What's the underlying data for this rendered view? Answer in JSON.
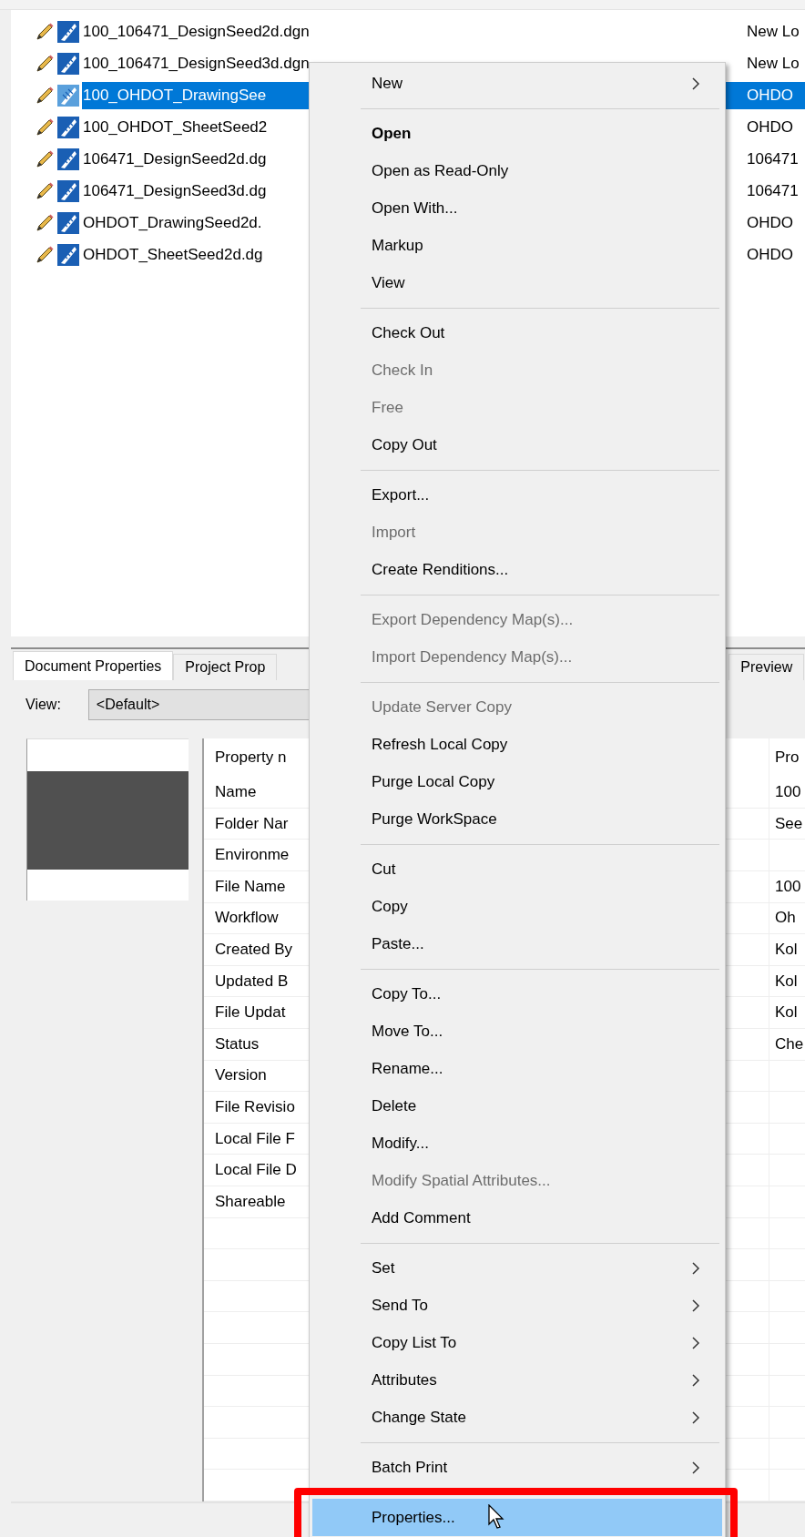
{
  "file_list": {
    "rows": [
      {
        "name": "100_106471_DesignSeed2d.dgn",
        "column_2": "New Lo",
        "selected": false
      },
      {
        "name": "100_106471_DesignSeed3d.dgn",
        "column_2": "New Lo",
        "selected": false
      },
      {
        "name": "100_OHDOT_DrawingSee",
        "column_2": "OHDO",
        "selected": true
      },
      {
        "name": "100_OHDOT_SheetSeed2",
        "column_2": "OHDO",
        "selected": false
      },
      {
        "name": "106471_DesignSeed2d.dg",
        "column_2": "106471",
        "selected": false
      },
      {
        "name": "106471_DesignSeed3d.dg",
        "column_2": "106471",
        "selected": false
      },
      {
        "name": "OHDOT_DrawingSeed2d.",
        "column_2": "OHDO",
        "selected": false
      },
      {
        "name": "OHDOT_SheetSeed2d.dg",
        "column_2": "OHDO",
        "selected": false
      }
    ]
  },
  "properties_panel": {
    "tabs": [
      {
        "label": "Document Properties",
        "selected": true
      },
      {
        "label": "Project Prop",
        "selected": false
      },
      {
        "label": "Preview",
        "selected": false
      }
    ],
    "view": {
      "label": "View:",
      "value": "<Default>"
    },
    "grid": {
      "columns": [
        "Property n",
        "Pro"
      ],
      "rows": [
        {
          "property": "Name",
          "value": "100"
        },
        {
          "property": "Folder Nar",
          "value": "See"
        },
        {
          "property": "Environme"
        },
        {
          "property": "File Name",
          "value": "100"
        },
        {
          "property": "Workflow",
          "value": "Oh"
        },
        {
          "property": "Created By",
          "value": "Kol"
        },
        {
          "property": "Updated B",
          "value": "Kol"
        },
        {
          "property": "File Updat",
          "value": "Kol"
        },
        {
          "property": "Status",
          "value": "Che"
        },
        {
          "property": "Version"
        },
        {
          "property": "File Revisio"
        },
        {
          "property": "Local File F"
        },
        {
          "property": "Local File D"
        },
        {
          "property": "Shareable"
        }
      ]
    }
  },
  "context_menu": {
    "items": [
      {
        "kind": "item",
        "label": "New",
        "bold": false,
        "disabled": false,
        "submenu": true,
        "selected": false
      },
      {
        "kind": "separator"
      },
      {
        "kind": "item",
        "label": "Open",
        "bold": true,
        "disabled": false,
        "submenu": false,
        "selected": false
      },
      {
        "kind": "item",
        "label": "Open as Read-Only",
        "bold": false,
        "disabled": false,
        "submenu": false,
        "selected": false
      },
      {
        "kind": "item",
        "label": "Open With...",
        "bold": false,
        "disabled": false,
        "submenu": false,
        "selected": false
      },
      {
        "kind": "item",
        "label": "Markup",
        "bold": false,
        "disabled": false,
        "submenu": false,
        "selected": false
      },
      {
        "kind": "item",
        "label": "View",
        "bold": false,
        "disabled": false,
        "submenu": false,
        "selected": false
      },
      {
        "kind": "separator"
      },
      {
        "kind": "item",
        "label": "Check Out",
        "bold": false,
        "disabled": false,
        "submenu": false,
        "selected": false
      },
      {
        "kind": "item",
        "label": "Check In",
        "bold": false,
        "disabled": true,
        "submenu": false,
        "selected": false
      },
      {
        "kind": "item",
        "label": "Free",
        "bold": false,
        "disabled": true,
        "submenu": false,
        "selected": false
      },
      {
        "kind": "item",
        "label": "Copy Out",
        "bold": false,
        "disabled": false,
        "submenu": false,
        "selected": false
      },
      {
        "kind": "separator"
      },
      {
        "kind": "item",
        "label": "Export...",
        "bold": false,
        "disabled": false,
        "submenu": false,
        "selected": false
      },
      {
        "kind": "item",
        "label": "Import",
        "bold": false,
        "disabled": true,
        "submenu": false,
        "selected": false
      },
      {
        "kind": "item",
        "label": "Create Renditions...",
        "bold": false,
        "disabled": false,
        "submenu": false,
        "selected": false
      },
      {
        "kind": "separator"
      },
      {
        "kind": "item",
        "label": "Export Dependency Map(s)...",
        "bold": false,
        "disabled": true,
        "submenu": false,
        "selected": false
      },
      {
        "kind": "item",
        "label": "Import Dependency Map(s)...",
        "bold": false,
        "disabled": true,
        "submenu": false,
        "selected": false
      },
      {
        "kind": "separator"
      },
      {
        "kind": "item",
        "label": "Update Server Copy",
        "bold": false,
        "disabled": true,
        "submenu": false,
        "selected": false
      },
      {
        "kind": "item",
        "label": "Refresh Local Copy",
        "bold": false,
        "disabled": false,
        "submenu": false,
        "selected": false
      },
      {
        "kind": "item",
        "label": "Purge Local Copy",
        "bold": false,
        "disabled": false,
        "submenu": false,
        "selected": false
      },
      {
        "kind": "item",
        "label": "Purge WorkSpace",
        "bold": false,
        "disabled": false,
        "submenu": false,
        "selected": false
      },
      {
        "kind": "separator"
      },
      {
        "kind": "item",
        "label": "Cut",
        "bold": false,
        "disabled": false,
        "submenu": false,
        "selected": false
      },
      {
        "kind": "item",
        "label": "Copy",
        "bold": false,
        "disabled": false,
        "submenu": false,
        "selected": false
      },
      {
        "kind": "item",
        "label": "Paste...",
        "bold": false,
        "disabled": false,
        "submenu": false,
        "selected": false
      },
      {
        "kind": "separator"
      },
      {
        "kind": "item",
        "label": "Copy To...",
        "bold": false,
        "disabled": false,
        "submenu": false,
        "selected": false
      },
      {
        "kind": "item",
        "label": "Move To...",
        "bold": false,
        "disabled": false,
        "submenu": false,
        "selected": false
      },
      {
        "kind": "item",
        "label": "Rename...",
        "bold": false,
        "disabled": false,
        "submenu": false,
        "selected": false
      },
      {
        "kind": "item",
        "label": "Delete",
        "bold": false,
        "disabled": false,
        "submenu": false,
        "selected": false
      },
      {
        "kind": "item",
        "label": "Modify...",
        "bold": false,
        "disabled": false,
        "submenu": false,
        "selected": false
      },
      {
        "kind": "item",
        "label": "Modify Spatial Attributes...",
        "bold": false,
        "disabled": true,
        "submenu": false,
        "selected": false
      },
      {
        "kind": "item",
        "label": "Add Comment",
        "bold": false,
        "disabled": false,
        "submenu": false,
        "selected": false
      },
      {
        "kind": "separator"
      },
      {
        "kind": "item",
        "label": "Set",
        "bold": false,
        "disabled": false,
        "submenu": true,
        "selected": false
      },
      {
        "kind": "item",
        "label": "Send To",
        "bold": false,
        "disabled": false,
        "submenu": true,
        "selected": false
      },
      {
        "kind": "item",
        "label": "Copy List To",
        "bold": false,
        "disabled": false,
        "submenu": true,
        "selected": false
      },
      {
        "kind": "item",
        "label": "Attributes",
        "bold": false,
        "disabled": false,
        "submenu": true,
        "selected": false
      },
      {
        "kind": "item",
        "label": "Change State",
        "bold": false,
        "disabled": false,
        "submenu": true,
        "selected": false
      },
      {
        "kind": "separator"
      },
      {
        "kind": "item",
        "label": "Batch Print",
        "bold": false,
        "disabled": false,
        "submenu": true,
        "selected": false
      },
      {
        "kind": "separator"
      },
      {
        "kind": "item",
        "label": "Properties...",
        "bold": false,
        "disabled": false,
        "submenu": false,
        "selected": true
      }
    ]
  }
}
